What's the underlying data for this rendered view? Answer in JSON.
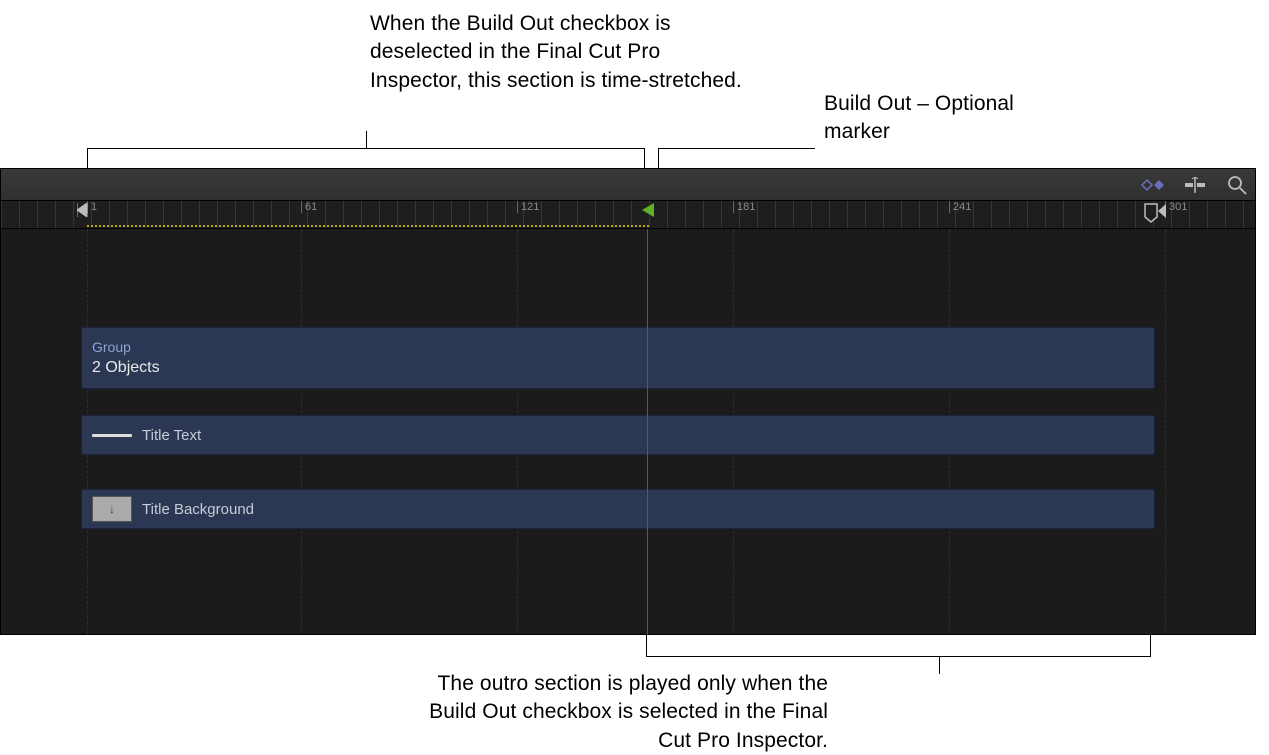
{
  "callouts": {
    "time_stretch": "When the Build Out checkbox is deselected in the Final Cut Pro Inspector, this section is time-stretched.",
    "build_out_marker": "Build Out – Optional marker",
    "outro": "The outro section is played only when the Build Out checkbox is selected in the Final Cut Pro Inspector."
  },
  "ruler": {
    "ticks": [
      "1",
      "61",
      "121",
      "181",
      "241",
      "301"
    ]
  },
  "tracks": {
    "group_label": "Group",
    "group_sub": "2 Objects",
    "title_text": "Title Text",
    "title_background": "Title Background"
  },
  "icons": {
    "keyframe": "keyframe-icon",
    "snap": "snap-icon",
    "zoom": "zoom-icon",
    "thumb_arrow": "↓"
  }
}
